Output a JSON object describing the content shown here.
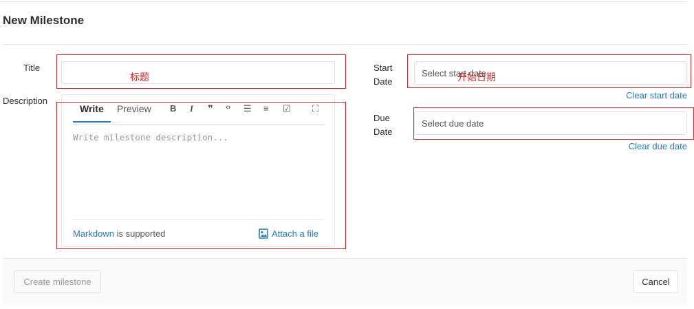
{
  "page": {
    "title": "New Milestone"
  },
  "form": {
    "title_label": "Title",
    "description_label": "Description",
    "start_label": "Start Date",
    "due_label": "Due Date",
    "start_placeholder": "Select start date",
    "due_placeholder": "Select due date",
    "clear_start": "Clear start date",
    "clear_due": "Clear due date"
  },
  "editor": {
    "tabs": [
      {
        "label": "Write"
      },
      {
        "label": "Preview"
      }
    ],
    "toolbar": [
      {
        "name": "bold-icon",
        "glyph": "B"
      },
      {
        "name": "italic-icon",
        "glyph": "I"
      },
      {
        "name": "quote-icon",
        "glyph": "❞"
      },
      {
        "name": "code-icon",
        "glyph": "‹›"
      },
      {
        "name": "bullet-list-icon",
        "glyph": "☰"
      },
      {
        "name": "numbered-list-icon",
        "glyph": "≡"
      },
      {
        "name": "task-list-icon",
        "glyph": "☑"
      },
      {
        "name": "fullscreen-icon",
        "glyph": "⛶"
      }
    ],
    "placeholder": "Write milestone description...",
    "markdown_link": "Markdown",
    "markdown_suffix": "is supported",
    "attach_label": "Attach a file"
  },
  "actions": {
    "create_label": "Create milestone",
    "cancel_label": "Cancel"
  },
  "annotations": {
    "title_note": "标题",
    "start_note": "开始日期"
  },
  "colors": {
    "link": "#1f78d1",
    "annotation": "#e02424"
  }
}
